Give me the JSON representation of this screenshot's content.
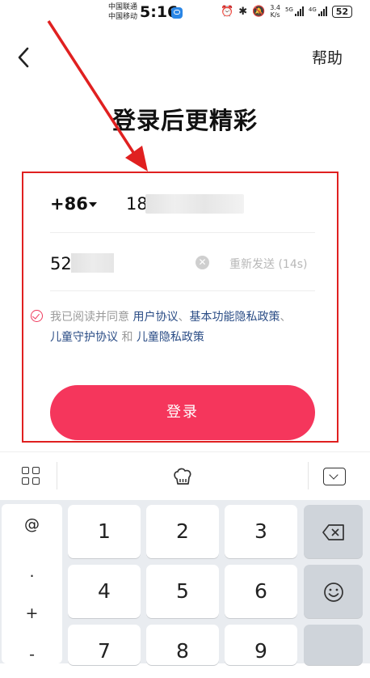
{
  "status_bar": {
    "carrier_1": "中国联通",
    "carrier_2": "中国移动",
    "time": "5:16",
    "speed_value": "3.4",
    "speed_unit": "K/s",
    "net_1": "5G",
    "net_2": "4G",
    "battery": "52"
  },
  "header": {
    "help": "帮助"
  },
  "title": "登录后更精彩",
  "form": {
    "country_code": "+86",
    "phone_visible": "18",
    "code_visible": "52",
    "resend": "重新发送 (14s)"
  },
  "agreement": {
    "prefix": "我已阅读并同意 ",
    "user_agreement": "用户协议",
    "sep1": "、",
    "basic_privacy": "基本功能隐私政策",
    "sep2": "、",
    "child_protection": "儿童守护协议",
    "and": " 和 ",
    "child_privacy": "儿童隐私政策"
  },
  "login_button": "登录",
  "keyboard": {
    "symbols": [
      "@",
      ".",
      "+",
      "-"
    ],
    "keys": [
      "1",
      "2",
      "3",
      "4",
      "5",
      "6",
      "7",
      "8",
      "9"
    ]
  },
  "colors": {
    "accent": "#f5365c",
    "link": "#2b4d86",
    "annotation": "#e02020"
  }
}
